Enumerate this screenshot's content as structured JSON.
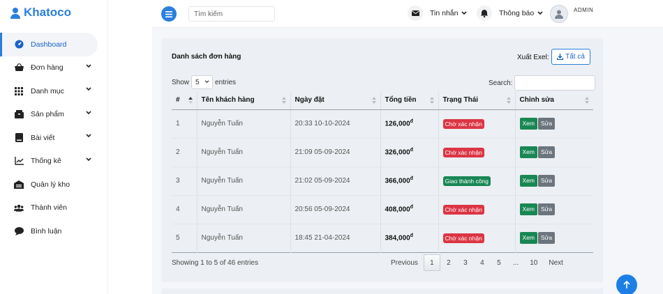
{
  "brand": {
    "name": "Khatoco"
  },
  "sidebar": {
    "items": [
      {
        "label": "Dashboard",
        "icon": "dashboard-icon",
        "active": true
      },
      {
        "label": "Đơn hàng",
        "icon": "basket-icon",
        "has_chevron": true
      },
      {
        "label": "Danh mục",
        "icon": "grid-icon",
        "has_chevron": true
      },
      {
        "label": "Sản phẩm",
        "icon": "box-icon",
        "has_chevron": true
      },
      {
        "label": "Bài viết",
        "icon": "book-icon",
        "has_chevron": true
      },
      {
        "label": "Thống kê",
        "icon": "chart-icon",
        "has_chevron": true
      },
      {
        "label": "Quản lý kho",
        "icon": "warehouse-icon"
      },
      {
        "label": "Thành viên",
        "icon": "users-icon"
      },
      {
        "label": "Bình luận",
        "icon": "comment-icon"
      }
    ]
  },
  "topbar": {
    "search_placeholder": "Tìm kiếm",
    "messages_label": "Tin nhắn",
    "notifications_label": "Thông báo",
    "admin_label": "ADMIN"
  },
  "card": {
    "title": "Danh sách đơn hàng",
    "export_label": "Xuất Exel:",
    "export_button": "Tất cả",
    "show_label": "Show",
    "show_value": "5",
    "entries_label": "entries",
    "search_label": "Search:"
  },
  "table": {
    "headers": [
      "#",
      "Tên khách hàng",
      "Ngày đặt",
      "Tổng tiền",
      "Trạng Thái",
      "Chỉnh sửa"
    ],
    "rows": [
      {
        "num": "1",
        "customer": "Nguyễn Tuấn",
        "date": "20:33 10-10-2024",
        "total": "126,000",
        "currency": "đ",
        "status": "Chờ xác nhận",
        "status_type": "pending"
      },
      {
        "num": "2",
        "customer": "Nguyễn Tuấn",
        "date": "21:09 05-09-2024",
        "total": "326,000",
        "currency": "đ",
        "status": "Chờ xác nhận",
        "status_type": "pending"
      },
      {
        "num": "3",
        "customer": "Nguyễn Tuấn",
        "date": "21:02 05-09-2024",
        "total": "366,000",
        "currency": "đ",
        "status": "Giao thành công",
        "status_type": "done"
      },
      {
        "num": "4",
        "customer": "Nguyễn Tuấn",
        "date": "20:56 05-09-2024",
        "total": "408,000",
        "currency": "đ",
        "status": "Chờ xác nhận",
        "status_type": "pending"
      },
      {
        "num": "5",
        "customer": "Nguyễn Tuấn",
        "date": "18:45 21-04-2024",
        "total": "384,000",
        "currency": "đ",
        "status": "Chờ xác nhận",
        "status_type": "pending"
      }
    ],
    "view_label": "Xem",
    "edit_label": "Sửa"
  },
  "footer": {
    "info": "Showing 1 to 5 of 46 entries",
    "pagination": [
      "Previous",
      "1",
      "2",
      "3",
      "4",
      "5",
      "...",
      "10",
      "Next"
    ],
    "current_page": "1"
  },
  "colors": {
    "primary": "#2a7fdc",
    "danger": "#dc3545",
    "success": "#198754",
    "secondary": "#6c757d"
  }
}
